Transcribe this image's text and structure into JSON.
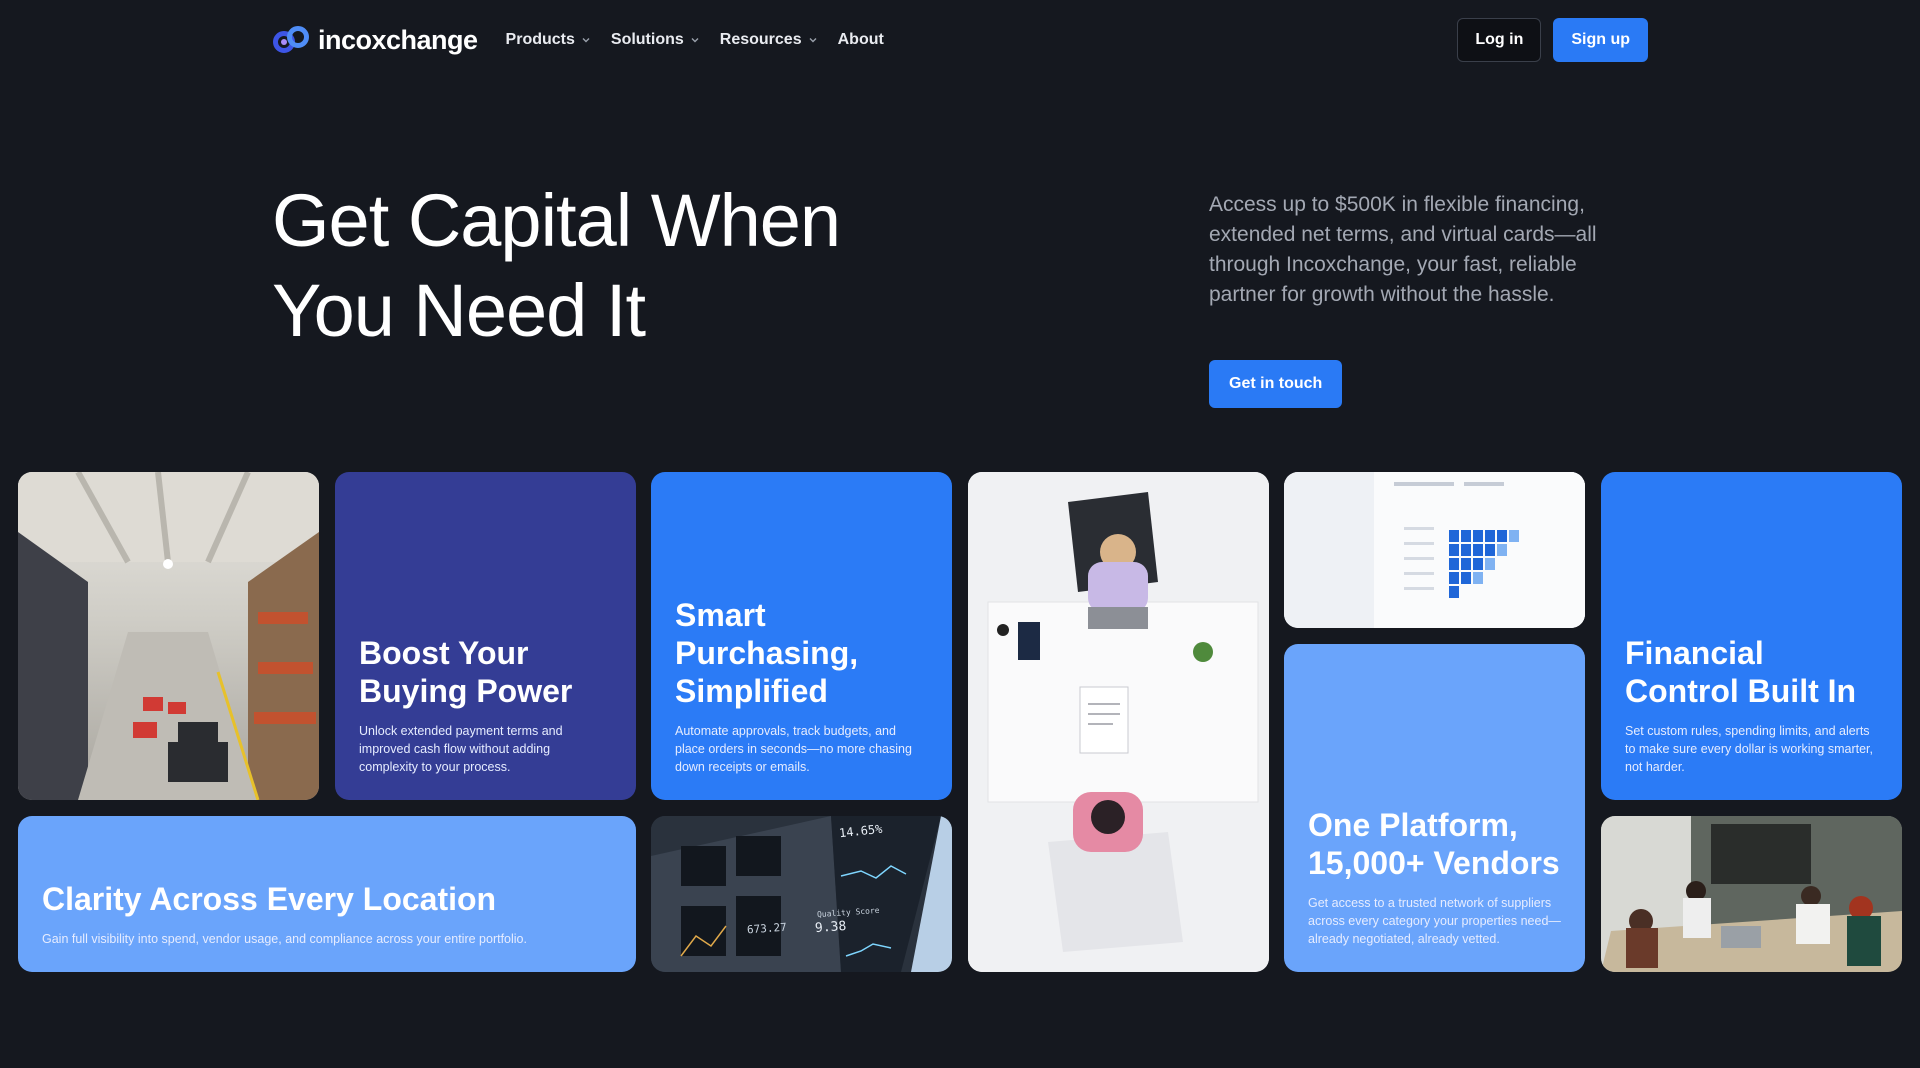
{
  "brand": {
    "name": "incoxchange",
    "accent": "#2a7af5",
    "logo_icon": "infinity-logo-icon"
  },
  "nav": {
    "items": [
      {
        "label": "Products",
        "has_dropdown": true
      },
      {
        "label": "Solutions",
        "has_dropdown": true
      },
      {
        "label": "Resources",
        "has_dropdown": true
      },
      {
        "label": "About",
        "has_dropdown": false
      }
    ],
    "login_label": "Log in",
    "signup_label": "Sign up"
  },
  "hero": {
    "title_line1": "Get Capital When",
    "title_line2": "You Need It",
    "description": "Access up to $500K in flexible financing, extended net terms, and virtual cards—all through Incoxchange, your fast, reliable partner for growth without the hassle.",
    "cta_label": "Get in touch"
  },
  "cards": {
    "boost": {
      "title": "Boost Your Buying Power",
      "text": "Unlock extended payment terms and improved cash flow without adding complexity to your process.",
      "color": "#343d95"
    },
    "smart": {
      "title": "Smart Purchasing, Simplified",
      "text": "Automate approvals, track budgets, and place orders in seconds—no more chasing down receipts or emails.",
      "color": "#2b7bf6"
    },
    "financial": {
      "title": "Financial Control Built In",
      "text": "Set custom rules, spending limits, and alerts to make sure every dollar is working smarter, not harder.",
      "color": "#2b7bf6"
    },
    "clarity": {
      "title": "Clarity Across Every Location",
      "text": "Gain full visibility into spend, vendor usage, and compliance across your entire portfolio.",
      "color": "#6aa4fb"
    },
    "platform": {
      "title": "One Platform, 15,000+ Vendors",
      "text": "Get access to a trusted network of suppliers across every category your properties need—already negotiated, already vetted.",
      "color": "#6aa4fb"
    }
  },
  "photos": {
    "monitor_values": [
      "14.65%",
      "9.38",
      "673.27"
    ],
    "monitor_labels": [
      "Quality Score"
    ]
  }
}
